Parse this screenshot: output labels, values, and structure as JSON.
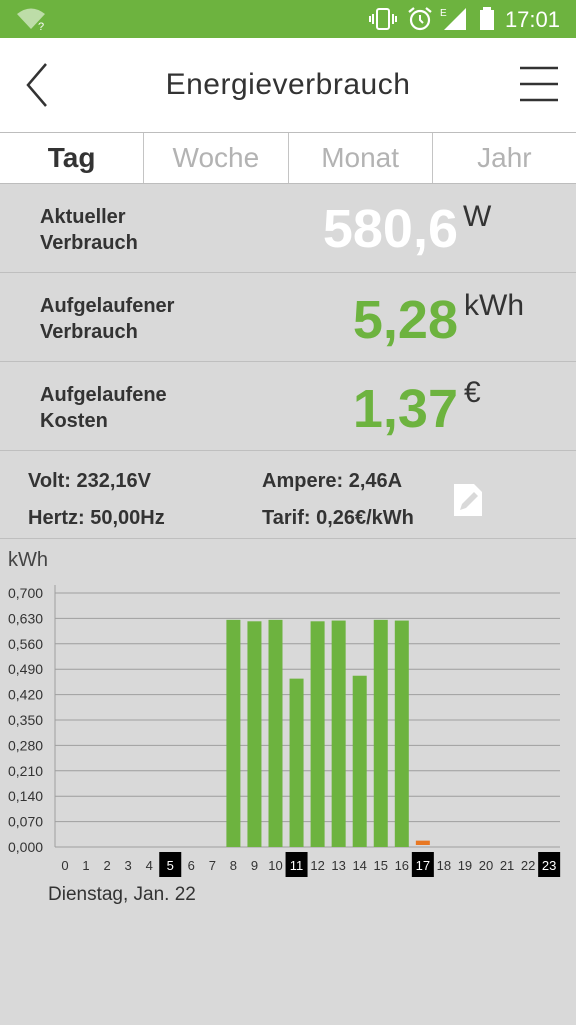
{
  "status_bar": {
    "time": "17:01",
    "wifi_badge": "?",
    "network_badge": "E"
  },
  "header": {
    "title": "Energieverbrauch",
    "back_icon": "chevron-left-icon",
    "menu_icon": "hamburger-menu-icon"
  },
  "tabs": [
    {
      "label": "Tag"
    },
    {
      "label": "Woche"
    },
    {
      "label": "Monat"
    },
    {
      "label": "Jahr"
    }
  ],
  "readings": {
    "current": {
      "label_line1": "Aktueller",
      "label_line2": "Verbrauch",
      "value": "580,6",
      "unit": "W",
      "color": "#ffffff"
    },
    "accumulated": {
      "label_line1": "Aufgelaufener",
      "label_line2": "Verbrauch",
      "value": "5,28",
      "unit": "kWh",
      "color": "#6db33f"
    },
    "cost": {
      "label_line1": "Aufgelaufene",
      "label_line2": "Kosten",
      "value": "1,37",
      "unit": "€",
      "color": "#6db33f"
    }
  },
  "details": {
    "volt": "Volt: 232,16V",
    "ampere": "Ampere: 2,46A",
    "hertz": "Hertz: 50,00Hz",
    "tarif": "Tarif: 0,26€/kWh"
  },
  "chart_data": {
    "type": "bar",
    "ylabel": "kWh",
    "yticks": [
      "0,000",
      "0,070",
      "0,140",
      "0,210",
      "0,280",
      "0,350",
      "0,420",
      "0,490",
      "0,560",
      "0,630",
      "0,700"
    ],
    "ylim": [
      0,
      0.7
    ],
    "categories": [
      "0",
      "1",
      "2",
      "3",
      "4",
      "5",
      "6",
      "7",
      "8",
      "9",
      "10",
      "11",
      "12",
      "13",
      "14",
      "15",
      "16",
      "17",
      "18",
      "19",
      "20",
      "21",
      "22",
      "23"
    ],
    "values": [
      0,
      0,
      0,
      0,
      0,
      0,
      0,
      0,
      0.626,
      0.622,
      0.626,
      0.464,
      0.622,
      0.624,
      0.472,
      0.626,
      0.624,
      0.012,
      0,
      0,
      0,
      0,
      0,
      0
    ],
    "highlighted_categories": [
      "5",
      "11",
      "17",
      "23"
    ],
    "current_category": "17",
    "bar_color": "#6db33f",
    "current_bar_color": "#e87722",
    "grid": true
  },
  "footer": {
    "date": "Dienstag, Jan. 22"
  }
}
